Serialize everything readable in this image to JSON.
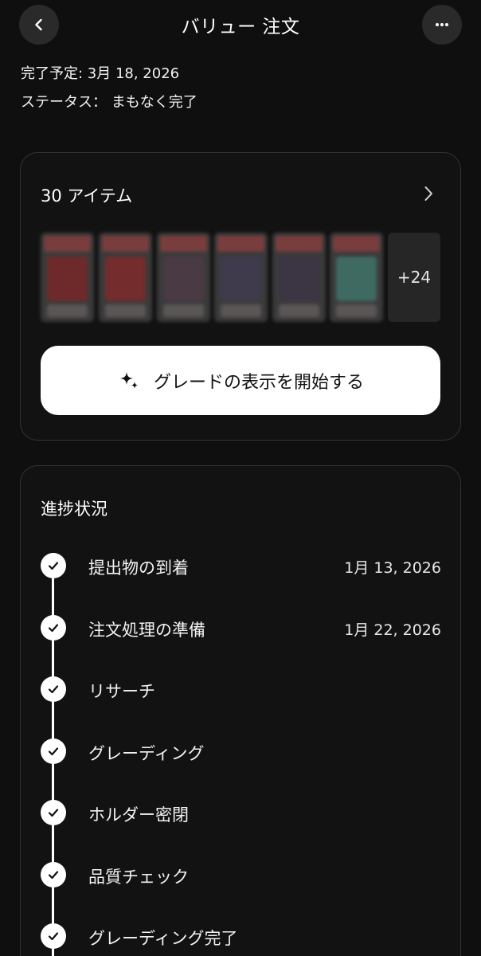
{
  "header": {
    "title": "バリュー 注文",
    "back_icon": "chevron-left-icon",
    "more_icon": "more-horizontal-icon"
  },
  "order": {
    "due": "完了予定: 3月 18, 2026",
    "status": "ステータス： まもなく完了"
  },
  "items": {
    "title": "30 アイテム",
    "more_count": "+24",
    "cta_label": "グレードの表示を開始する",
    "cta_icon": "sparkle-icon"
  },
  "progress": {
    "title": "進捗状況",
    "steps": [
      {
        "label": "提出物の到着",
        "date": "1月 13, 2026"
      },
      {
        "label": "注文処理の準備",
        "date": "1月 22, 2026"
      },
      {
        "label": "リサーチ",
        "date": ""
      },
      {
        "label": "グレーディング",
        "date": ""
      },
      {
        "label": "ホルダー密閉",
        "date": ""
      },
      {
        "label": "品質チェック",
        "date": ""
      },
      {
        "label": "グレーディング完了",
        "date": ""
      }
    ]
  },
  "colors": {
    "background": "#0f0f0f",
    "card_border": "#333333",
    "cta_background": "#ffffff"
  }
}
